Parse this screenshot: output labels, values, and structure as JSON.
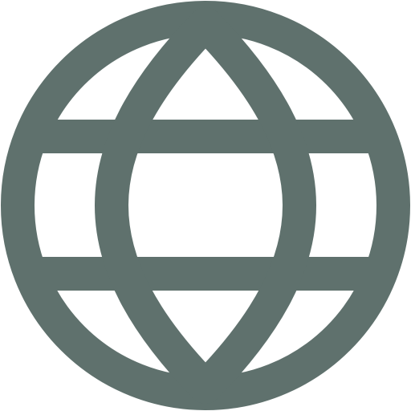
{
  "icon": {
    "name": "globe-icon",
    "color": "#5f716d",
    "background": "#ffffff"
  }
}
